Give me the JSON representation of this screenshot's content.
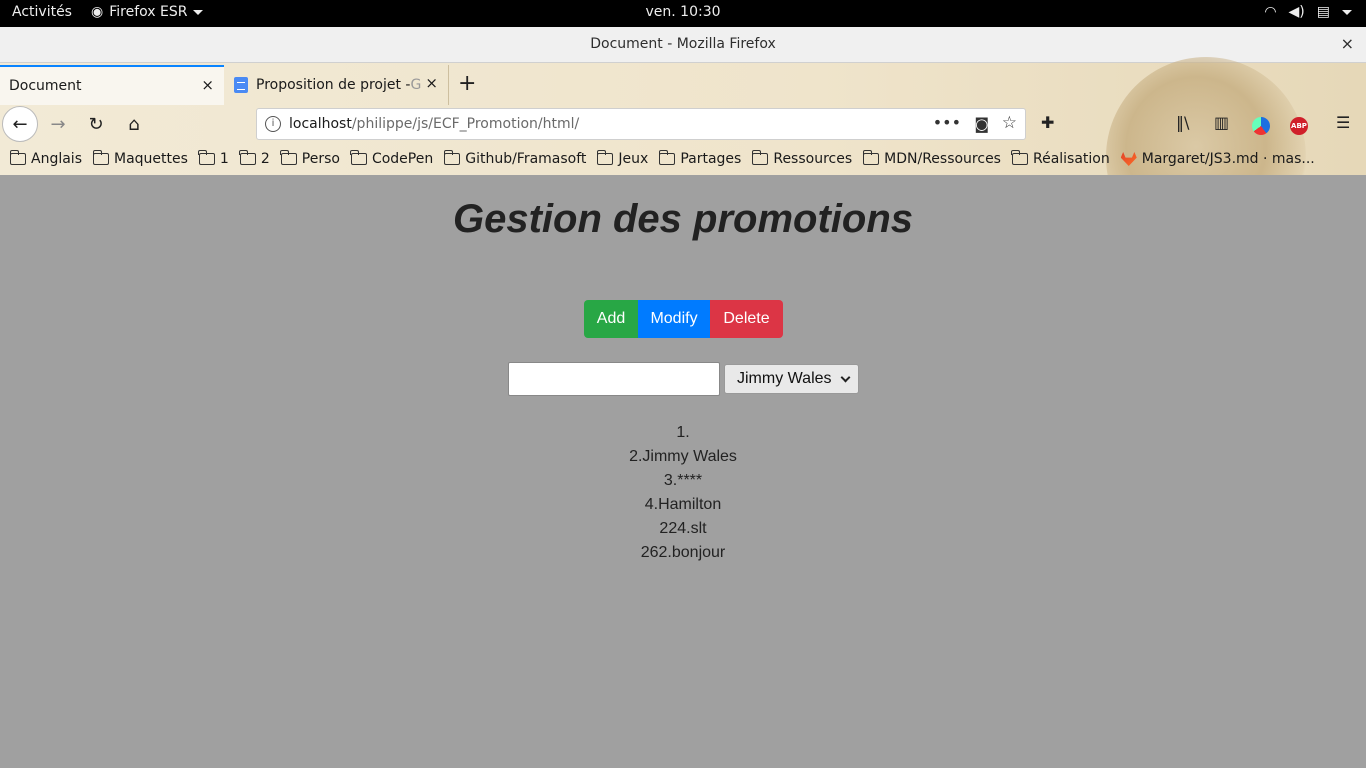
{
  "system": {
    "activities": "Activités",
    "app_name": "Firefox ESR",
    "clock": "ven. 10:30"
  },
  "window": {
    "title": "Document - Mozilla Firefox",
    "close": "×"
  },
  "tabs": [
    {
      "label": "Document",
      "close": "×"
    },
    {
      "label": "Proposition de projet - ",
      "label_fade": "G",
      "close": "×"
    }
  ],
  "newtab": "+",
  "urlbar": {
    "host": "localhost",
    "path": "/philippe/js/ECF_Promotion/html/"
  },
  "bookmarks": [
    {
      "label": "Anglais",
      "icon": "folder-icon"
    },
    {
      "label": "Maquettes",
      "icon": "folder-icon"
    },
    {
      "label": "1",
      "icon": "folder-icon"
    },
    {
      "label": "2",
      "icon": "folder-icon"
    },
    {
      "label": "Perso",
      "icon": "folder-icon"
    },
    {
      "label": "CodePen",
      "icon": "folder-icon"
    },
    {
      "label": "Github/Framasoft",
      "icon": "folder-icon"
    },
    {
      "label": "Jeux",
      "icon": "folder-icon"
    },
    {
      "label": "Partages",
      "icon": "folder-icon"
    },
    {
      "label": "Ressources",
      "icon": "folder-icon"
    },
    {
      "label": "MDN/Ressources",
      "icon": "folder-icon"
    },
    {
      "label": "Réalisation",
      "icon": "folder-icon"
    },
    {
      "label": "Margaret/JS3.md · mas...",
      "icon": "gitlab-icon"
    }
  ],
  "page": {
    "heading": "Gestion des promotions",
    "buttons": {
      "add": "Add",
      "modify": "Modify",
      "delete": "Delete"
    },
    "input_value": "",
    "select_value": "Jimmy Wales",
    "list": [
      "1.",
      "2.Jimmy Wales",
      "3.****",
      "4.Hamilton",
      "224.slt",
      "262.bonjour"
    ]
  },
  "colors": {
    "background": "#a0a0a0",
    "add": "#28a745",
    "modify": "#007bff",
    "delete": "#dc3545"
  }
}
